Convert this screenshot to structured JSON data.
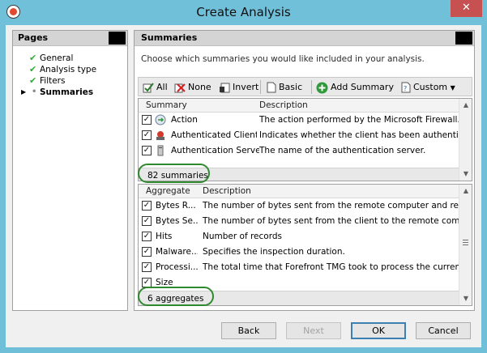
{
  "window": {
    "title": "Create Analysis",
    "close_label": "✕"
  },
  "pages_panel": {
    "header": "Pages",
    "items": [
      {
        "label": "General",
        "status": "done"
      },
      {
        "label": "Analysis type",
        "status": "done"
      },
      {
        "label": "Filters",
        "status": "done"
      },
      {
        "label": "Summaries",
        "status": "current"
      }
    ]
  },
  "summaries_panel": {
    "header": "Summaries",
    "instruction": "Choose which summaries you would like included in your analysis.",
    "toolbar": {
      "all_label": "All",
      "none_label": "None",
      "invert_label": "Invert",
      "basic_label": "Basic",
      "add_summary_label": "Add Summary",
      "custom_label": "Custom"
    },
    "summary_table": {
      "columns": [
        "Summary",
        "Description"
      ],
      "rows": [
        {
          "name": "Action",
          "description": "The action performed by the Microsoft Firewall...",
          "checked": true,
          "icon": "action-icon"
        },
        {
          "name": "Authenticated Client",
          "description": "Indicates whether the client has been authentic...",
          "checked": true,
          "icon": "auth-client-icon"
        },
        {
          "name": "Authentication Server",
          "description": "The name of the authentication server.",
          "checked": true,
          "icon": "auth-server-icon"
        }
      ],
      "count_text": "82 summaries"
    },
    "aggregate_table": {
      "columns": [
        "Aggregate",
        "Description"
      ],
      "rows": [
        {
          "name": "Bytes R...",
          "description": "The number of bytes sent from the remote computer and rece...",
          "checked": true
        },
        {
          "name": "Bytes Se...",
          "description": "The number of bytes sent from the client to the remote comp...",
          "checked": true
        },
        {
          "name": "Hits",
          "description": "Number of records",
          "checked": true
        },
        {
          "name": "Malware...",
          "description": "Specifies the inspection duration.",
          "checked": true
        },
        {
          "name": "Processi...",
          "description": "The total time that Forefront TMG took to process the current...",
          "checked": true
        },
        {
          "name": "Size",
          "description": "",
          "checked": true
        }
      ],
      "count_text": "6 aggregates"
    }
  },
  "buttons": {
    "back": "Back",
    "next": "Next",
    "ok": "OK",
    "cancel": "Cancel"
  },
  "colors": {
    "title_bar": "#70c0da",
    "close_button": "#c75050",
    "check_green": "#35a83a",
    "highlight_ring": "#2f8a2f"
  }
}
